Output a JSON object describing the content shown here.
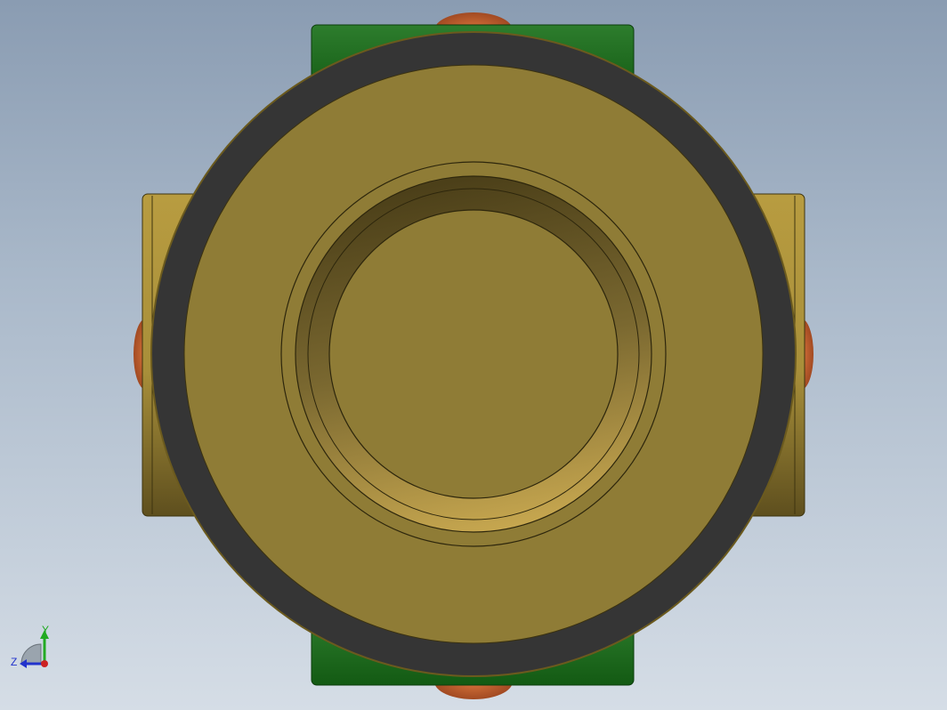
{
  "viewport": {
    "background_top": "#8a9cb2",
    "background_bottom": "#d5dde6"
  },
  "model": {
    "colors": {
      "brass": "#8f7c36",
      "brass_light": "#c4a84a",
      "brass_dark": "#5a4b20",
      "gasket": "#353535",
      "green_tab": "#1e6e1e",
      "orange_knob": "#c46030"
    }
  },
  "triad": {
    "y_label": "Y",
    "z_label": "Z",
    "y_color": "#22aa22",
    "z_color": "#2233cc",
    "x_color": "#cc2222"
  }
}
